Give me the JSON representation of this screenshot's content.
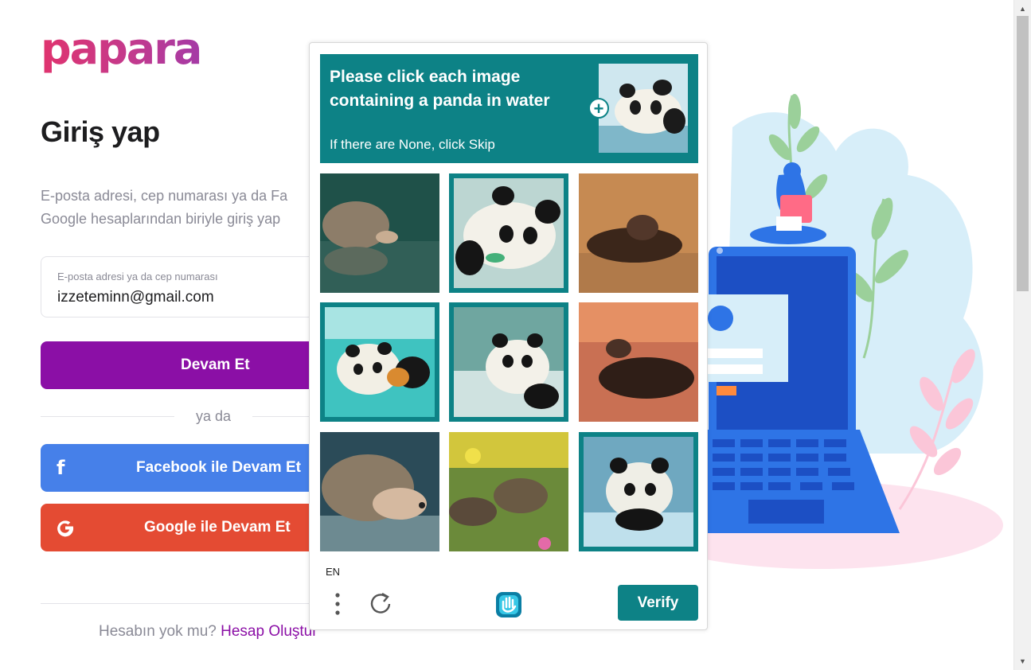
{
  "brand": {
    "logo_text": "papara"
  },
  "login": {
    "title": "Giriş yap",
    "subtitle_line1": "E-posta adresi, cep numarası ya da Fa",
    "subtitle_line2": "Google hesaplarından biriyle giriş yap",
    "input_label": "E-posta adresi ya da cep numarası",
    "input_value": "izzeteminn@gmail.com",
    "continue_label": "Devam Et",
    "or_label": "ya da",
    "facebook_label": "Facebook ile Devam Et",
    "google_label": "Google ile Devam Et",
    "no_account": "Hesabın yok mu?",
    "create_account": "Hesap Oluştur",
    "colors": {
      "primary": "#8b0fa6",
      "facebook": "#4680e9",
      "google": "#e44b33"
    }
  },
  "captcha": {
    "prompt": "Please click each image containing a panda in water",
    "sub": "If there are None, click Skip",
    "language": "EN",
    "verify_label": "Verify",
    "accent": "#0d8286",
    "tiles": [
      {
        "subject": "hedgehog-in-water",
        "selected": false
      },
      {
        "subject": "panda",
        "selected": true
      },
      {
        "subject": "otter",
        "selected": false
      },
      {
        "subject": "panda",
        "selected": true
      },
      {
        "subject": "panda",
        "selected": true
      },
      {
        "subject": "otter",
        "selected": false
      },
      {
        "subject": "hedgehog",
        "selected": false
      },
      {
        "subject": "otter-in-flowers",
        "selected": false
      },
      {
        "subject": "panda",
        "selected": true
      }
    ]
  }
}
